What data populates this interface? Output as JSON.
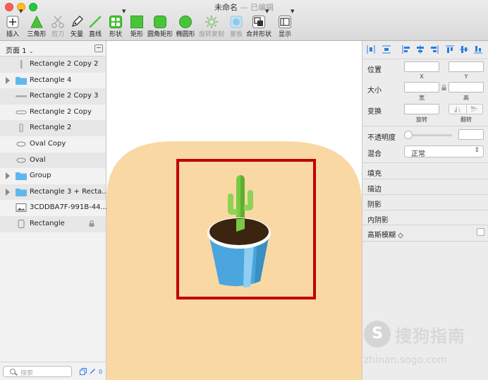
{
  "window": {
    "title": "未命名",
    "separator": " — ",
    "status": "已编辑"
  },
  "toolbar": {
    "items": [
      {
        "label": "插入",
        "icon": "plus-icon"
      },
      {
        "label": "三角形",
        "icon": "triangle-icon"
      },
      {
        "label": "剪刀",
        "icon": "scissors-icon"
      },
      {
        "label": "矢量",
        "icon": "vector-pen-icon"
      },
      {
        "label": "直线",
        "icon": "line-icon"
      },
      {
        "label": "形状",
        "icon": "shapes-icon"
      },
      {
        "label": "矩形",
        "icon": "rectangle-icon"
      },
      {
        "label": "圆角矩形",
        "icon": "rounded-rectangle-icon"
      },
      {
        "label": "椭圆形",
        "icon": "oval-icon"
      },
      {
        "label": "旋转复制",
        "icon": "rotate-copy-icon"
      },
      {
        "label": "蒙板",
        "icon": "mask-icon"
      },
      {
        "label": "合并形状",
        "icon": "combine-shapes-icon"
      },
      {
        "label": "显示",
        "icon": "view-icon"
      }
    ]
  },
  "sidebar": {
    "page_selector": "页面 1",
    "search_placeholder": "搜索",
    "badge_count": "0",
    "layers": [
      {
        "name": "Rectangle 2 Copy 2",
        "icon": "vertical-bar-icon",
        "group": false
      },
      {
        "name": "Rectangle 4",
        "icon": "folder-icon",
        "group": true
      },
      {
        "name": "Rectangle 2 Copy 3",
        "icon": "horizontal-bar-icon",
        "group": false
      },
      {
        "name": "Rectangle 2 Copy",
        "icon": "pill-icon",
        "group": false
      },
      {
        "name": "Rectangle 2",
        "icon": "vertical-pill-icon",
        "group": false
      },
      {
        "name": "Oval Copy",
        "icon": "oval-icon",
        "group": false
      },
      {
        "name": "Oval",
        "icon": "oval-icon",
        "group": false
      },
      {
        "name": "Group",
        "icon": "folder-icon",
        "group": true
      },
      {
        "name": "Rectangle 3 + Recta...",
        "icon": "folder-icon",
        "group": true
      },
      {
        "name": "3CDDBA7F-991B-44...",
        "icon": "image-icon",
        "group": false
      },
      {
        "name": "Rectangle",
        "icon": "rounded-rect-icon",
        "group": false,
        "locked": true
      }
    ]
  },
  "inspector": {
    "position_label": "位置",
    "x_label": "X",
    "y_label": "Y",
    "size_label": "大小",
    "width_label": "宽",
    "height_label": "高",
    "transform_label": "变换",
    "rotate_label": "旋转",
    "flip_label": "翻转",
    "opacity_label": "不透明度",
    "blend_label": "混合",
    "blend_value": "正常",
    "sections": [
      "填充",
      "描边",
      "阴影",
      "内阴影"
    ],
    "blur_label": "高斯模糊 ◇"
  },
  "watermark": {
    "logo": "S",
    "text": "搜狗指南",
    "url": "zhinan.sogo.com"
  },
  "colors": {
    "canvas_shape": "#f9d8a4",
    "selection_frame": "#c20000",
    "pot": "#4aa6dc",
    "soil": "#3b2510",
    "cactus": "#7ac943",
    "accent": "#2a7be4"
  }
}
